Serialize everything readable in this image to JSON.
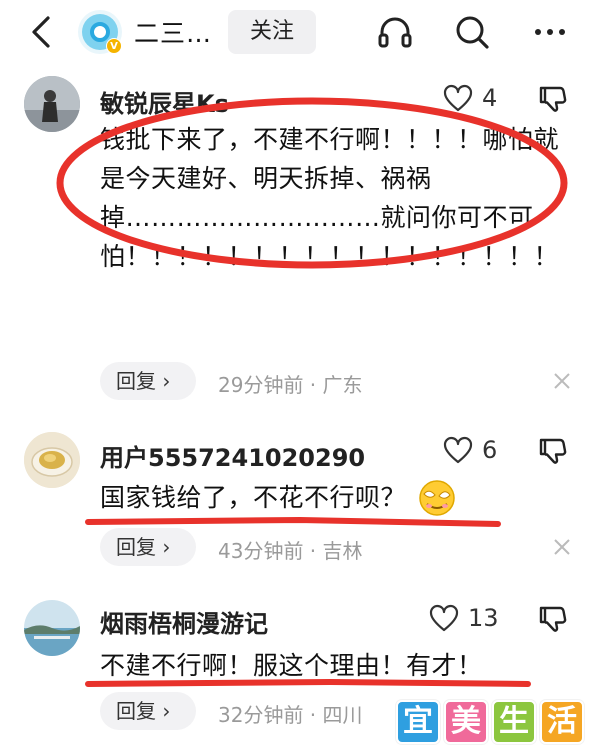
{
  "header": {
    "account_name": "二三…",
    "follow_label": "关注",
    "icons": [
      "back-icon",
      "headphones-icon",
      "search-icon",
      "more-icon"
    ]
  },
  "comments": [
    {
      "username": "敏锐辰星Ks",
      "likes": "4",
      "text": "钱批下来了，不建不行啊！！！！哪怕就是今天建好、明天拆掉、祸祸掉…………………………就问你可不可怕！！！！！！！！！！！！！！！！！",
      "reply_label": "回复 ›",
      "meta": "29分钟前 · 广东"
    },
    {
      "username": "用户5557241020290",
      "likes": "6",
      "text": "国家钱给了，不花不行呗？",
      "reply_label": "回复 ›",
      "meta": "43分钟前 · 吉林"
    },
    {
      "username": "烟雨梧桐漫游记",
      "likes": "13",
      "text": "不建不行啊！服这个理由！有才！",
      "reply_label": "回复 ›",
      "meta": "32分钟前 · 四川"
    }
  ],
  "watermark": {
    "chars": [
      "宜",
      "美",
      "生",
      "活"
    ],
    "colors": [
      "#2f9fe0",
      "#f06a9a",
      "#8cc63f",
      "#f5a623"
    ]
  },
  "colors": {
    "annotation_red": "#e8322b",
    "meta_gray": "#9a9a9a",
    "reply_bg": "#f2f2f4"
  }
}
